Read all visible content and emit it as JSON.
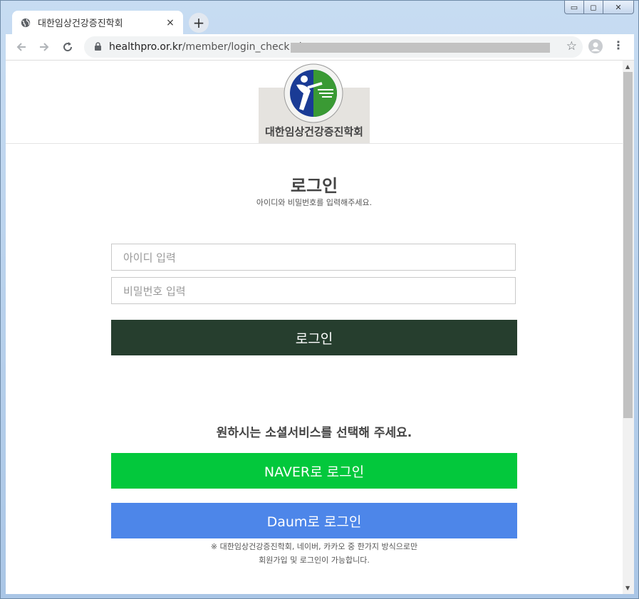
{
  "browser": {
    "tab_title": "대한임상건강증진학회",
    "tab_close": "×",
    "new_tab": "+",
    "url_host": "healthpro.or.kr",
    "url_path": "/member/login_check.php",
    "win_minimize": "▭",
    "win_maximize": "◻",
    "win_close": "✕"
  },
  "header": {
    "logo_text": "대한임상건강증진학회"
  },
  "login": {
    "title": "로그인",
    "subtitle": "아이디와 비밀번호를 입력해주세요.",
    "id_placeholder": "아이디 입력",
    "pw_placeholder": "비밀번호 입력",
    "button": "로그인"
  },
  "social": {
    "title": "원하시는 소셜서비스를 선택해 주세요.",
    "naver_button": "NAVER로 로그인",
    "daum_button": "Daum로 로그인",
    "note_line1": "※ 대한임상건강증진학회, 네이버, 카카오 중 한가지 방식으로만",
    "note_line2": "회원가입 및 로그인이 가능합니다."
  },
  "colors": {
    "login_button": "#263e2e",
    "naver": "#03c83c",
    "daum": "#4d86e9"
  }
}
